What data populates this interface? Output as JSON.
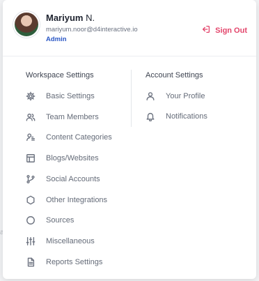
{
  "user": {
    "first_name": "Mariyum",
    "last_name": "N.",
    "email": "mariyum.noor@d4interactive.io",
    "role": "Admin"
  },
  "actions": {
    "sign_out": "Sign Out"
  },
  "workspace": {
    "title": "Workspace Settings",
    "items": [
      {
        "label": "Basic Settings",
        "icon": "gear-icon"
      },
      {
        "label": "Team Members",
        "icon": "users-icon"
      },
      {
        "label": "Content Categories",
        "icon": "user-list-icon"
      },
      {
        "label": "Blogs/Websites",
        "icon": "layout-icon"
      },
      {
        "label": "Social Accounts",
        "icon": "git-branch-icon"
      },
      {
        "label": "Other Integrations",
        "icon": "hexagon-icon"
      },
      {
        "label": "Sources",
        "icon": "circle-icon"
      },
      {
        "label": "Miscellaneous",
        "icon": "sliders-icon"
      },
      {
        "label": "Reports Settings",
        "icon": "document-icon"
      }
    ]
  },
  "account": {
    "title": "Account Settings",
    "items": [
      {
        "label": "Your Profile",
        "icon": "user-icon"
      },
      {
        "label": "Notifications",
        "icon": "bell-icon"
      }
    ]
  },
  "colors": {
    "accent": "#2a57c5",
    "danger": "#e3456b"
  }
}
